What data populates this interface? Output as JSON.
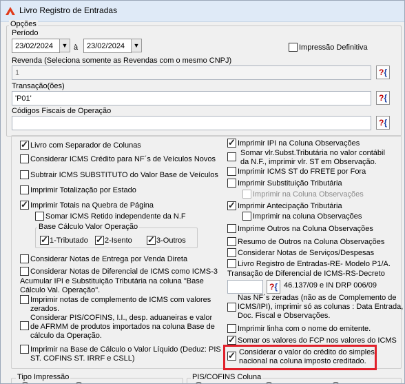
{
  "window": {
    "title": "Livro Registro de Entradas"
  },
  "opcoes": {
    "title": "Opções",
    "periodo_label": "Período",
    "date_from": "23/02/2024",
    "date_sep": "à",
    "date_to": "23/02/2024",
    "impressao_definitiva": {
      "label": "Impressão Definitiva",
      "checked": false
    },
    "revenda_label": "Revenda (Seleciona somente as Revendas com o mesmo CNPJ)",
    "revenda_value": "1",
    "transacao_label": "Transação(ões)",
    "transacao_value": "'P01'",
    "cfop_label": "Códigos Fiscais de Operação",
    "cfop_value": "",
    "lookup_q": "?",
    "lookup_b": "{"
  },
  "left_options": [
    {
      "label": "Livro com Separador de Colunas",
      "checked": true
    },
    {
      "label": "Considerar ICMS Crédito para NF´s de Veículos Novos",
      "checked": false
    },
    {
      "label": "Subtrair ICMS SUBSTITUTO do Valor Base de Veículos",
      "checked": false
    },
    {
      "label": "Imprimir Totalização por Estado",
      "checked": false
    },
    {
      "label": "Imprimir Totais na Quebra de Página",
      "checked": true
    },
    {
      "label": "Somar ICMS Retido independente da N.F",
      "checked": false
    },
    {
      "label": "Considerar Notas de Entrega por Venda Direta",
      "checked": false
    },
    {
      "label": "Considerar Notas de Diferencial de ICMS como ICMS-3",
      "checked": false
    },
    {
      "label": "Imprimir notas de complemento de ICMS com valores",
      "checked": false
    },
    {
      "label": "Considerar PIS/COFINS, I.I., desp. aduaneiras e valor",
      "checked": false
    },
    {
      "label": "Imprimir na Base de Cálculo o Valor Líquido (Deduz: PIS",
      "checked": false
    }
  ],
  "left_text": {
    "base_calculo_title": "Base Cálculo Valor Operação",
    "base_opts": [
      {
        "label": "1-Tributado",
        "checked": true
      },
      {
        "label": "2-Isento",
        "checked": true
      },
      {
        "label": "3-Outros",
        "checked": true
      }
    ],
    "acumular_1": "Acumular IPI e Substituição Tributária na coluna \"Base",
    "acumular_2": "Cálculo Val. Operação\".",
    "complemento_2": "zerados.",
    "pis_2": "de AFRMM de produtos importados na coluna Base de",
    "pis_3": "cálculo da Operação.",
    "liquido_2": "ST. COFINS ST. IRRF e CSLL)"
  },
  "right_options": [
    {
      "label": "Imprimir IPI na Coluna Observações",
      "checked": true
    },
    {
      "label": "Somar vlr.Subst.Tributária no valor contábil",
      "checked": false
    },
    {
      "label": "Imprimir ICMS ST do FRETE por Fora",
      "checked": false
    },
    {
      "label": "Imprimir Substituição Tributária",
      "checked": false
    },
    {
      "label": "Imprimir na Coluna Observações",
      "checked": false,
      "disabled": true
    },
    {
      "label": "Imprimir Antecipação Tributária",
      "checked": true
    },
    {
      "label": "Imprimir na coluna Observações",
      "checked": false
    },
    {
      "label": "Imprime Outros na Coluna Observações",
      "checked": false
    },
    {
      "label": "Resumo de Outros na Coluna Observações",
      "checked": false
    },
    {
      "label": "Considerar Notas de Serviços/Despesas",
      "checked": false
    },
    {
      "label": "Livro Registro de Entradas-RE- Modelo P1/A.",
      "checked": false
    },
    {
      "label": "Nas NF´s zeradas (não as de Complemento de",
      "checked": false
    },
    {
      "label": "Imprimir linha com o nome do emitente.",
      "checked": false
    },
    {
      "label": "Somar os valores do FCP  nos valores do ICMS",
      "checked": true
    },
    {
      "label": "Considerar o valor do crédito do simples",
      "checked": true
    }
  ],
  "right_text": {
    "somar_2": "da N.F., imprimir vlr. ST em Observação.",
    "transacao_dif": "Transação de Diferencial de ICMS-RS-Decreto",
    "decreto": "46.137/09  e IN DRP 006/09",
    "zeradas_2": "ICMS/IPI), imprimir só as colunas : Data Entrada,",
    "zeradas_3": "Doc. Fiscal e Observações.",
    "simples_2": "nacional na coluna imposto creditado."
  },
  "bottom": {
    "tipo_impressao": "Tipo Impressão",
    "pis_cofins_coluna": "PIS/COFINS Coluna"
  }
}
